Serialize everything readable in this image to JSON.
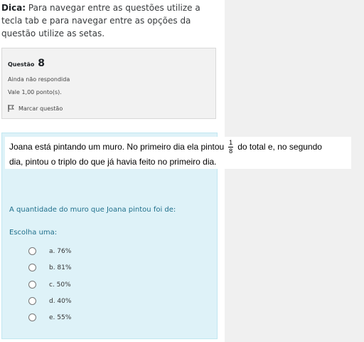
{
  "tip": {
    "strong": "Dica:",
    "text": " Para navegar entre as questões utilize a tecla tab e para navegar entre as opções da questão utilize as setas."
  },
  "info": {
    "question_label": "Questão",
    "question_number": "8",
    "state": "Ainda não respondida",
    "grade": "Vale 1,00 ponto(s).",
    "flag_label": "Marcar questão"
  },
  "question": {
    "line1_before": "Joana está pintando um muro. No primeiro dia ela pintou",
    "fraction_num": "1",
    "fraction_den": "8",
    "line1_after": "do total e, no segundo",
    "line2": "dia, pintou o triplo do que já havia feito no primeiro dia.",
    "prompt": "A quantidade do muro que Joana pintou foi de:",
    "choose_label": "Escolha uma:",
    "options": [
      {
        "label": "a. 76%"
      },
      {
        "label": "b. 81%"
      },
      {
        "label": "c. 50%"
      },
      {
        "label": "d. 40%"
      },
      {
        "label": "e. 55%"
      }
    ]
  }
}
